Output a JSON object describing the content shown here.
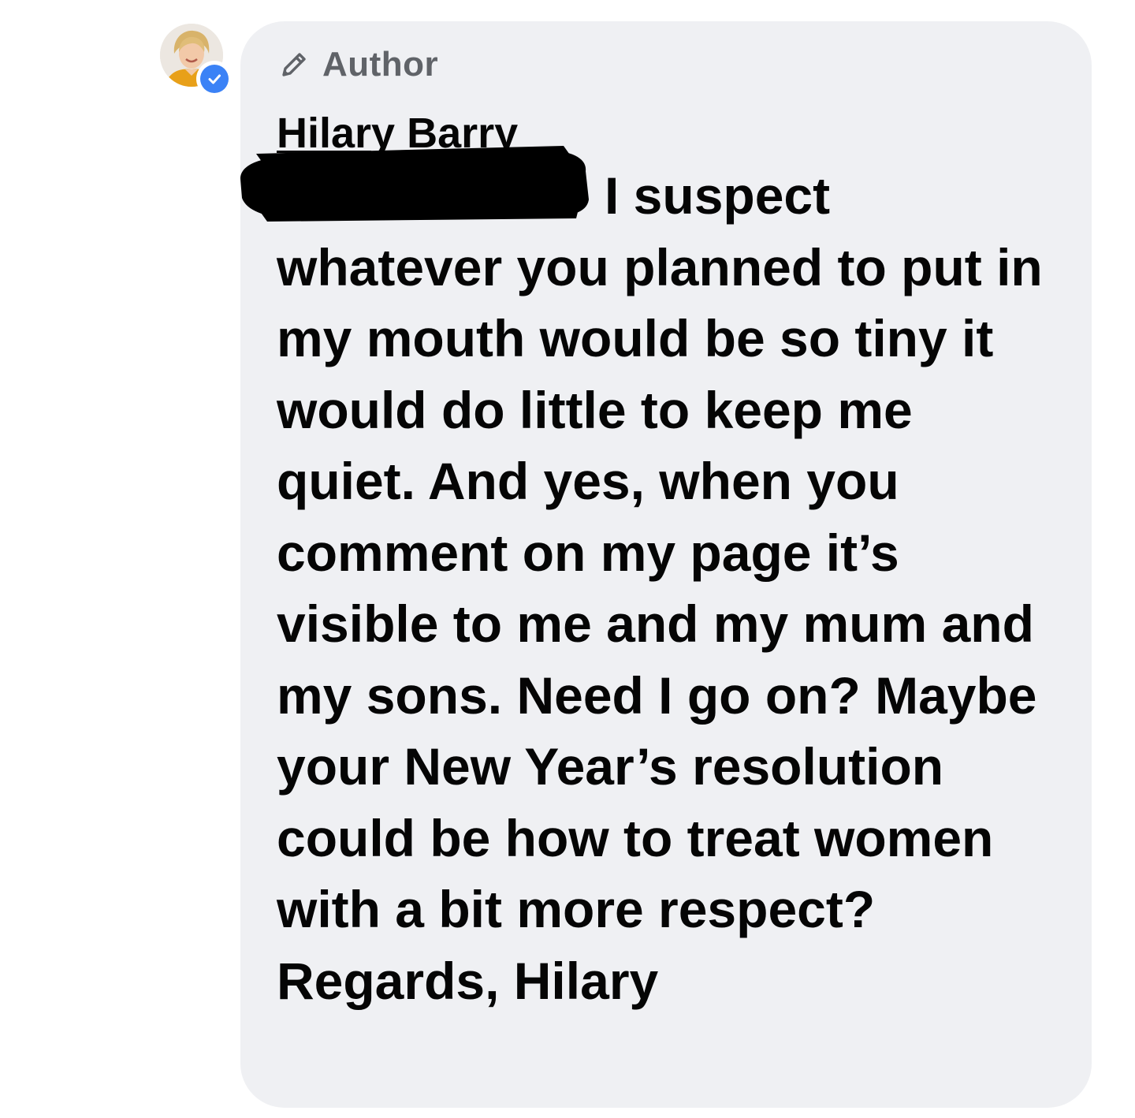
{
  "comment": {
    "badge_label": "Author",
    "author_name": "Hilary Barry",
    "text": "I suspect whatever you planned to put in my mouth would be so tiny it would do little to keep me quiet. And yes, when you comment on my page it’s visible to me and my mum and my sons. Need I go on? Maybe your New Year’s resolution could be how to treat women with a bit more respect? Regards, Hilary",
    "icons": {
      "badge": "pencil-icon",
      "avatar": "profile-photo",
      "verified": "verified-checkmark-icon"
    }
  },
  "colors": {
    "bubble_bg": "#eff0f3",
    "text": "#050505",
    "badge_text": "#606368",
    "verified": "#3b82f6",
    "redaction": "#000000"
  }
}
